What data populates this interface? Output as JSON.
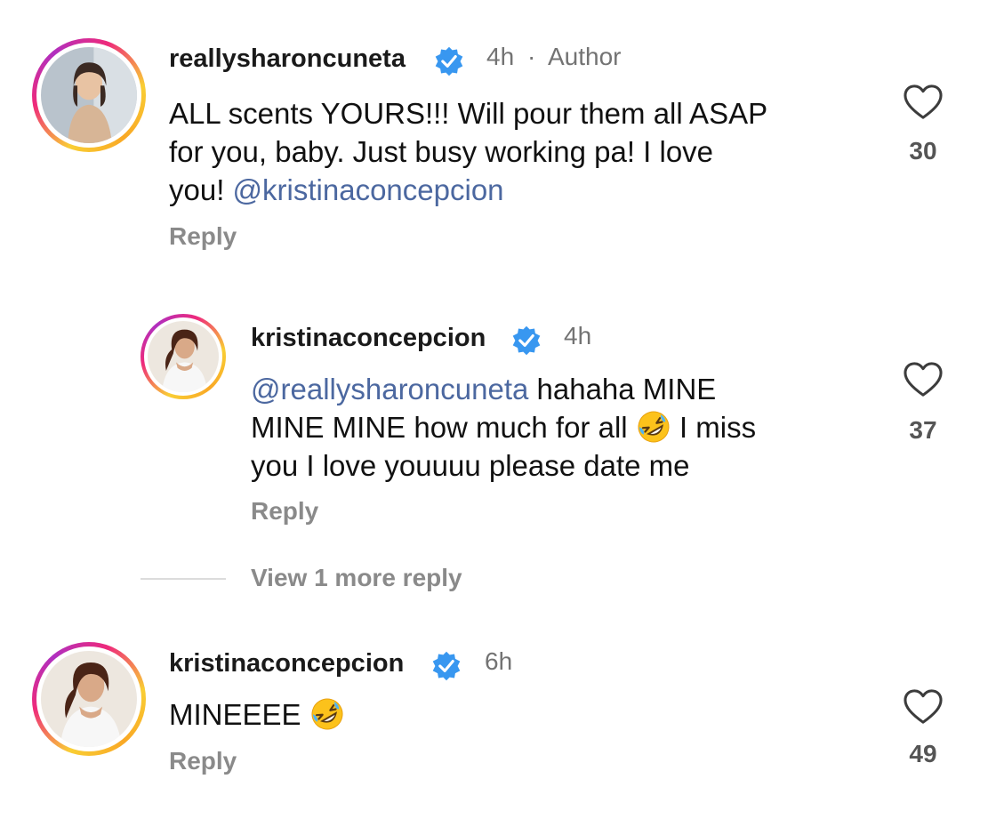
{
  "comments": [
    {
      "username": "reallysharoncuneta",
      "time": "4h",
      "separator": "·",
      "badge": "Author",
      "lines": [
        {
          "text": "ALL scents YOURS!!! Will pour them all ASAP"
        },
        {
          "text": "for you, baby. Just busy working pa! I love"
        },
        {
          "text": "you! ",
          "mention": "@kristinaconcepcion"
        }
      ],
      "reply_label": "Reply",
      "likes": "30"
    },
    {
      "username": "kristinaconcepcion",
      "time": "4h",
      "lines": [
        {
          "mention": "@reallysharoncuneta",
          "text": " hahaha MINE"
        },
        {
          "text": "MINE MINE how much for all",
          "emoji": "rolling-on-floor-laughing",
          "text_after": " I miss"
        },
        {
          "text": "you I love youuuu please date me"
        }
      ],
      "reply_label": "Reply",
      "likes": "37"
    },
    {
      "username": "kristinaconcepcion",
      "time": "6h",
      "lines": [
        {
          "text": "MINEEEE",
          "emoji": "rolling-on-floor-laughing"
        }
      ],
      "reply_label": "Reply",
      "likes": "49"
    }
  ],
  "view_more_label": "View 1 more reply",
  "icons": {
    "verified": "verified-badge-icon",
    "like": "heart-outline-icon",
    "emoji": "rolling-on-floor-laughing-emoji"
  },
  "colors": {
    "verified_blue": "#3897f0",
    "mention_blue": "#4c68a0",
    "meta_gray": "#737373",
    "reply_gray": "#8a8a8a"
  }
}
